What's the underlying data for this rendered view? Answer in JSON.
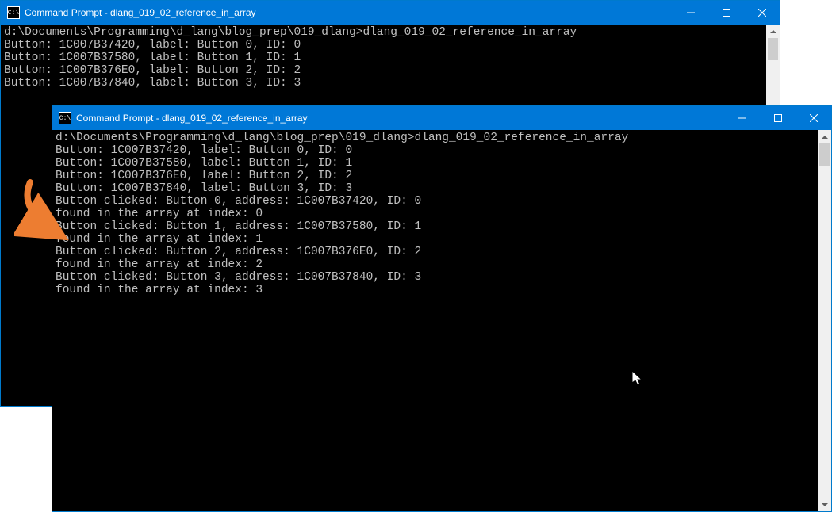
{
  "window_back": {
    "title": "Command Prompt - dlang_019_02_reference_in_array",
    "lines": [
      "",
      "d:\\Documents\\Programming\\d_lang\\blog_prep\\019_dlang>dlang_019_02_reference_in_array",
      "Button: 1C007B37420, label: Button 0, ID: 0",
      "Button: 1C007B37580, label: Button 1, ID: 1",
      "Button: 1C007B376E0, label: Button 2, ID: 2",
      "Button: 1C007B37840, label: Button 3, ID: 3"
    ]
  },
  "window_front": {
    "title": "Command Prompt - dlang_019_02_reference_in_array",
    "lines": [
      "",
      "d:\\Documents\\Programming\\d_lang\\blog_prep\\019_dlang>dlang_019_02_reference_in_array",
      "Button: 1C007B37420, label: Button 0, ID: 0",
      "Button: 1C007B37580, label: Button 1, ID: 1",
      "Button: 1C007B376E0, label: Button 2, ID: 2",
      "Button: 1C007B37840, label: Button 3, ID: 3",
      "",
      "",
      "Button clicked: Button 0, address: 1C007B37420, ID: 0",
      "found in the array at index: 0",
      "",
      "Button clicked: Button 1, address: 1C007B37580, ID: 1",
      "found in the array at index: 1",
      "",
      "Button clicked: Button 2, address: 1C007B376E0, ID: 2",
      "found in the array at index: 2",
      "",
      "Button clicked: Button 3, address: 1C007B37840, ID: 3",
      "found in the array at index: 3"
    ]
  },
  "colors": {
    "titlebar": "#0078d7",
    "terminal_bg": "#000000",
    "terminal_fg": "#c0c0c0",
    "arrow": "#ed7d31"
  }
}
